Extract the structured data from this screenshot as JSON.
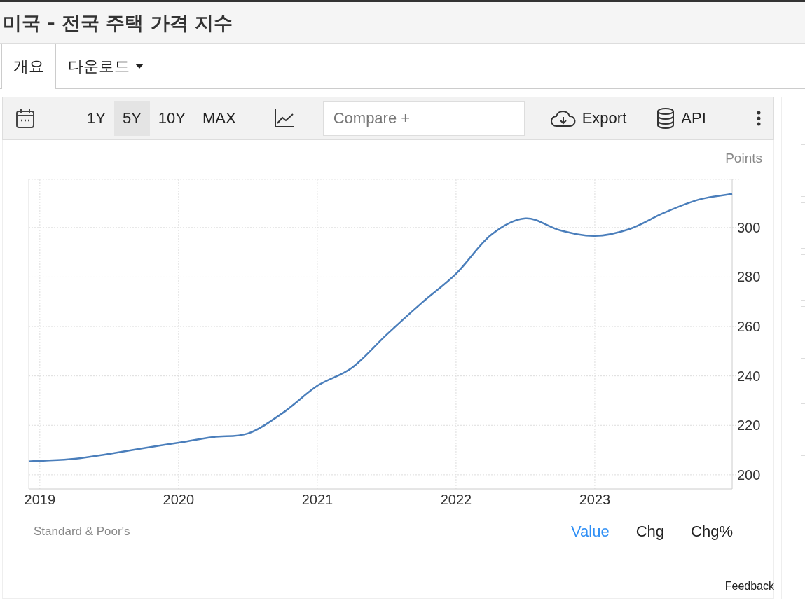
{
  "title": "미국 - 전국 주택 가격 지수",
  "tabs": [
    {
      "label": "개요",
      "selected": true,
      "kind": "tab"
    },
    {
      "label": "다운로드",
      "selected": false,
      "kind": "dropdown"
    }
  ],
  "toolbar": {
    "ranges": [
      {
        "label": "1Y",
        "selected": false
      },
      {
        "label": "5Y",
        "selected": true
      },
      {
        "label": "10Y",
        "selected": false
      },
      {
        "label": "MAX",
        "selected": false
      }
    ],
    "compare": {
      "placeholder": "Compare +"
    },
    "export": "Export",
    "api": "API"
  },
  "chart": {
    "unit": "Points",
    "source": "Standard & Poor's",
    "views": [
      {
        "label": "Value",
        "selected": true
      },
      {
        "label": "Chg",
        "selected": false
      },
      {
        "label": "Chg%",
        "selected": false
      }
    ],
    "chart_data": {
      "type": "line",
      "x": [
        2018.92,
        2019.0,
        2019.25,
        2019.5,
        2019.75,
        2020.0,
        2020.25,
        2020.5,
        2020.75,
        2021.0,
        2021.25,
        2021.5,
        2021.75,
        2022.0,
        2022.25,
        2022.5,
        2022.75,
        2023.0,
        2023.25,
        2023.5,
        2023.75,
        2023.99
      ],
      "grid": true,
      "series": [
        {
          "color": "#4a7ebb",
          "values": [
            205.4,
            205.7,
            206.5,
            208.5,
            210.8,
            213,
            215.3,
            216.7,
            225,
            236,
            243.3,
            256.7,
            269.4,
            281.3,
            296.9,
            303.7,
            298.9,
            296.6,
            299.4,
            306,
            311.3,
            313.6
          ]
        }
      ],
      "xlim": [
        2018.92,
        2023.99
      ],
      "ylim": [
        194.3,
        319.5
      ],
      "xticks": [
        {
          "value": 2019,
          "label": "2019"
        },
        {
          "value": 2020,
          "label": "2020"
        },
        {
          "value": 2021,
          "label": "2021"
        },
        {
          "value": 2022,
          "label": "2022"
        },
        {
          "value": 2023,
          "label": "2023"
        }
      ],
      "yticks": [
        {
          "value": 200,
          "label": "200"
        },
        {
          "value": 220,
          "label": "220"
        },
        {
          "value": 240,
          "label": "240"
        },
        {
          "value": 260,
          "label": "260"
        },
        {
          "value": 280,
          "label": "280"
        },
        {
          "value": 300,
          "label": "300"
        }
      ]
    }
  },
  "feedback": "Feedback"
}
